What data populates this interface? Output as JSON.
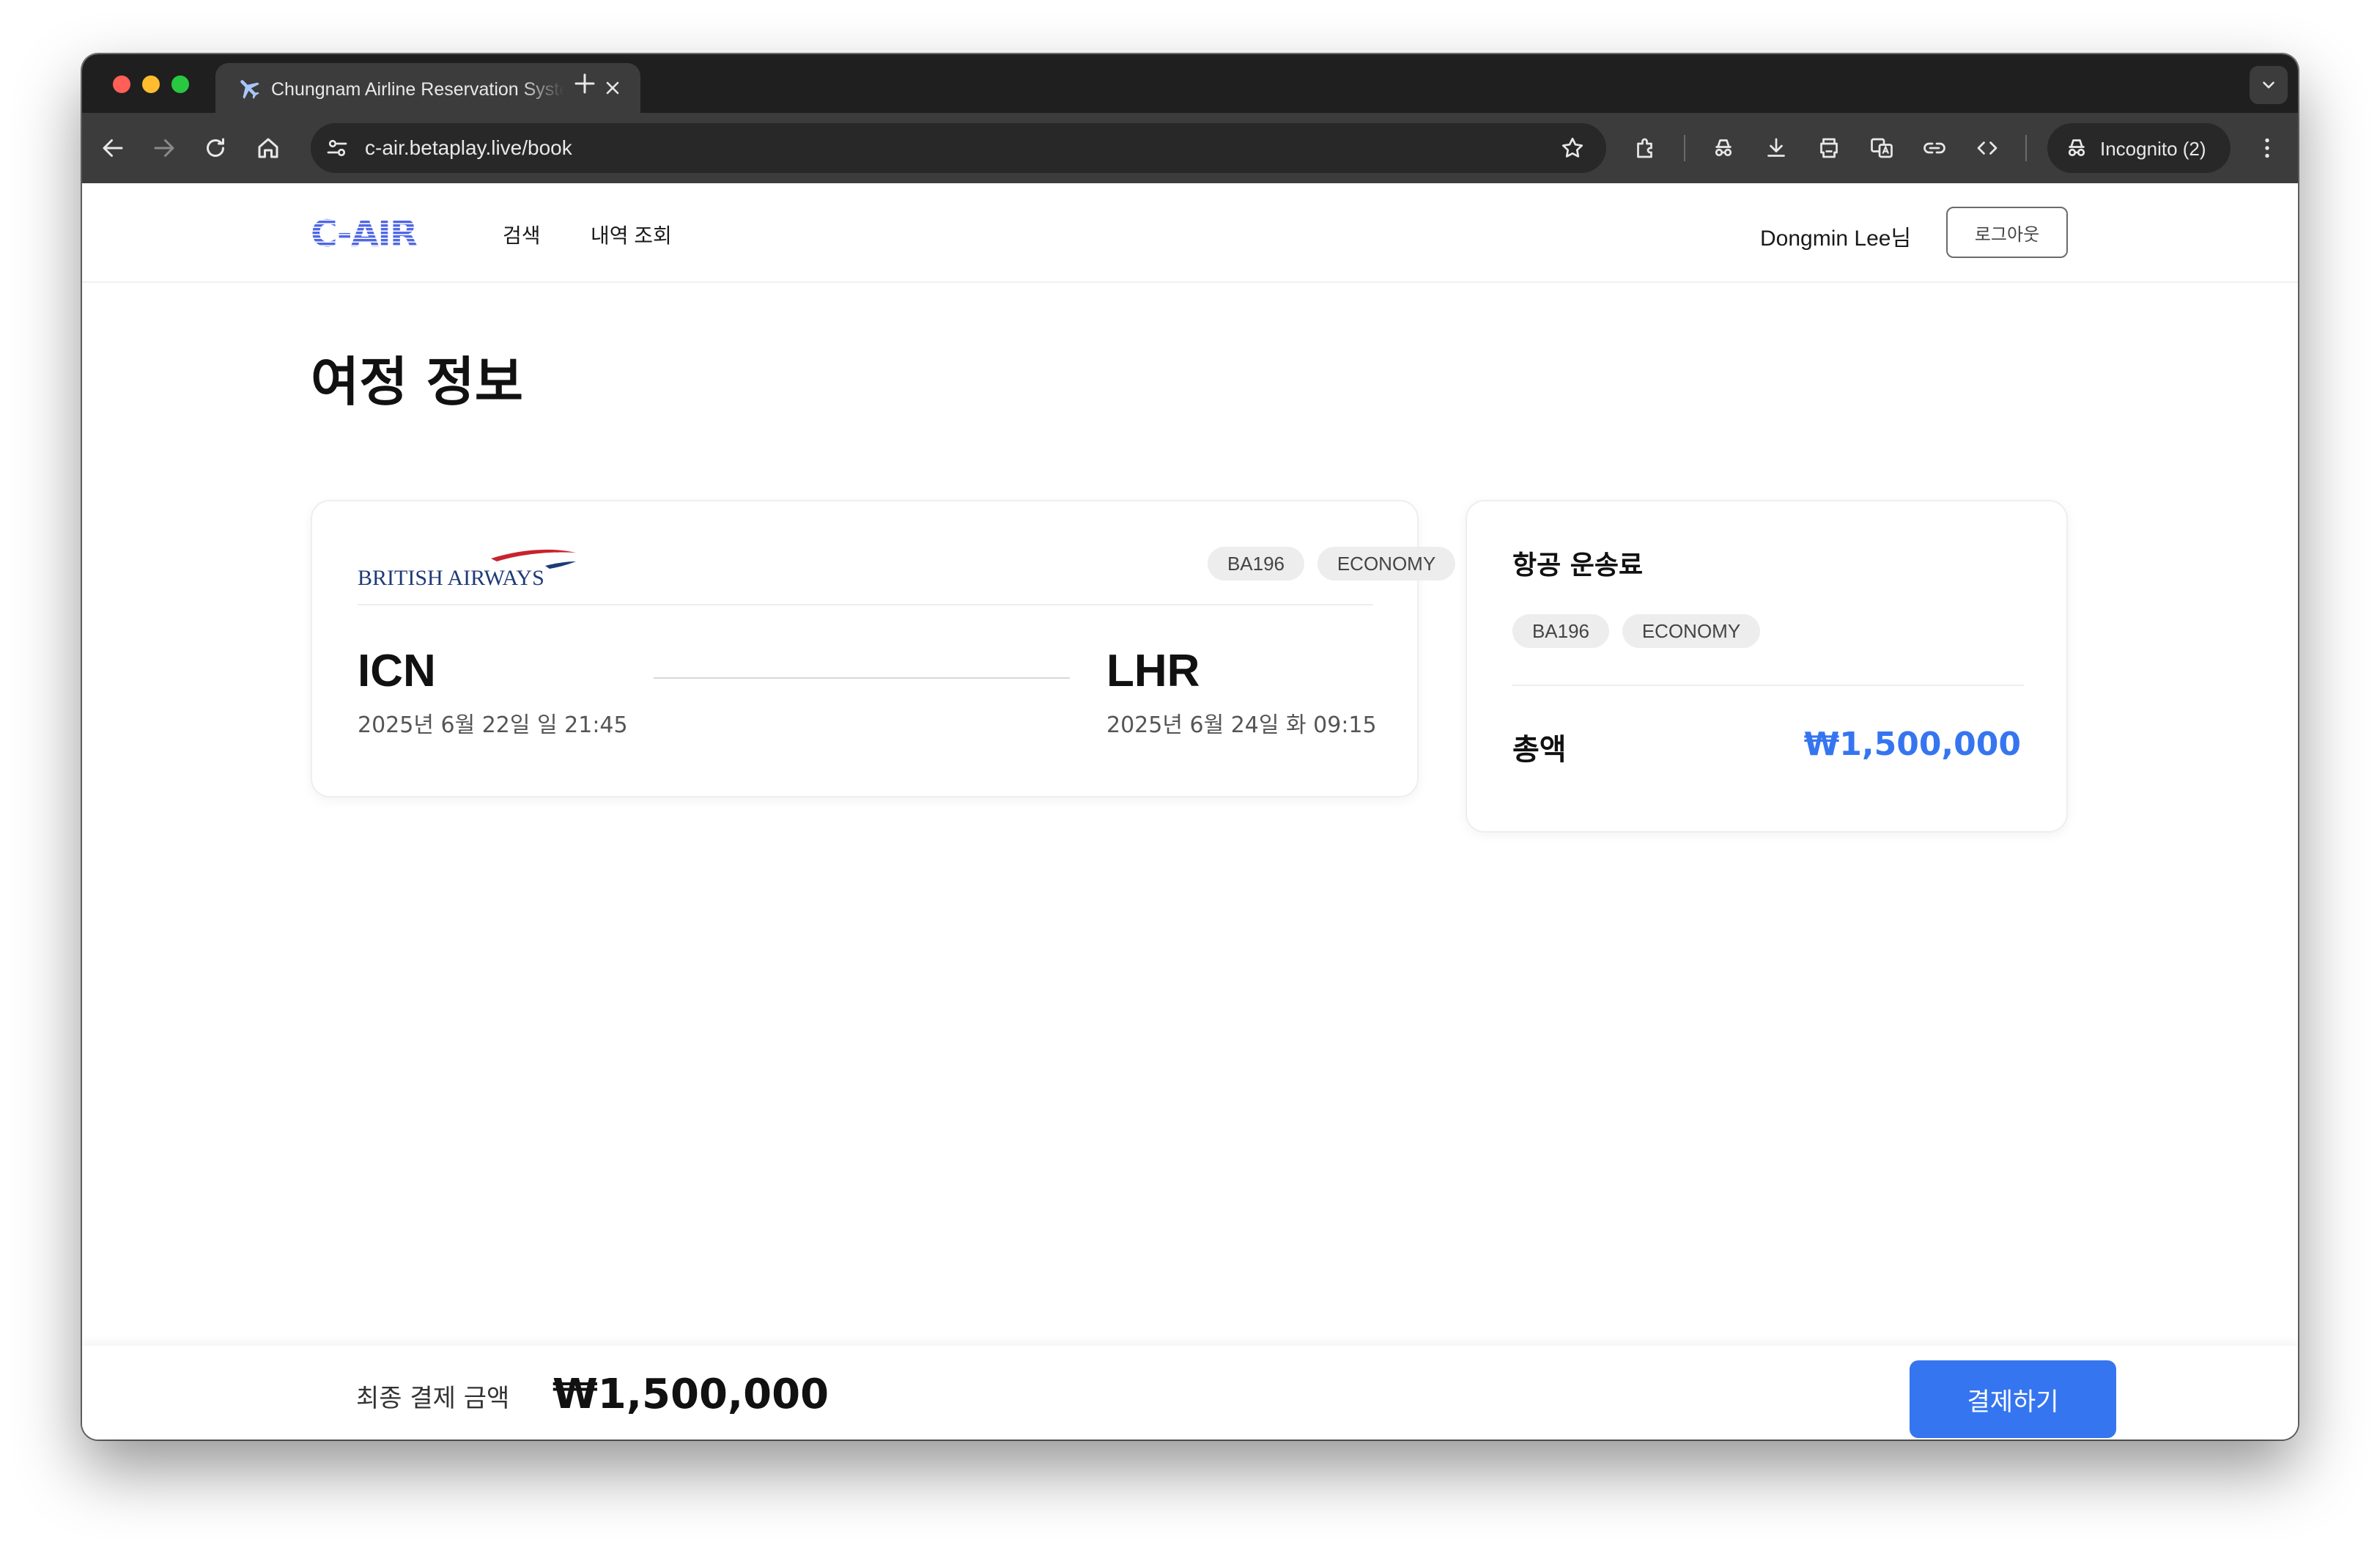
{
  "browser": {
    "tab_title": "Chungnam Airline Reservation System",
    "address": "c-air.betaplay.live/book",
    "incognito_label": "Incognito (2)",
    "icons": {
      "tab_favicon": "airplane-icon",
      "tab_close": "close-icon",
      "new_tab": "plus-icon",
      "tab_search": "chevron-down-icon",
      "back": "back-arrow-icon",
      "forward": "forward-arrow-icon",
      "reload": "reload-icon",
      "home": "home-icon",
      "site_info": "tune-icon",
      "bookmark": "star-icon",
      "extensions": "puzzle-icon",
      "incognito": "incognito-icon",
      "download": "download-icon",
      "print": "printer-icon",
      "translate": "translate-icon",
      "link": "link-icon",
      "devtools": "code-icon",
      "menu": "kebab-menu-icon"
    }
  },
  "site": {
    "logo_text": "C-AIR",
    "nav": {
      "search": "검색",
      "history": "내역 조회"
    },
    "user_name": "Dongmin Lee님",
    "logout": "로그아웃"
  },
  "page": {
    "title": "여정 정보"
  },
  "flight": {
    "airline": "BRITISH AIRWAYS",
    "flight_code": "BA196",
    "cabin": "ECONOMY",
    "departure": {
      "code": "ICN",
      "datetime": "2025년 6월 22일 일 21:45"
    },
    "arrival": {
      "code": "LHR",
      "datetime": "2025년 6월 24일 화 09:15"
    }
  },
  "fare": {
    "title": "항공 운송료",
    "flight_code": "BA196",
    "cabin": "ECONOMY",
    "total_label": "총액",
    "total_value": "₩1,500,000"
  },
  "footer": {
    "final_label": "최종 결제 금액",
    "final_amount": "₩1,500,000",
    "pay_button": "결제하기"
  },
  "colors": {
    "accent": "#3575f0",
    "logo": "#4f67e6",
    "airline_navy": "#1e3a78",
    "airline_red": "#c8232c"
  }
}
